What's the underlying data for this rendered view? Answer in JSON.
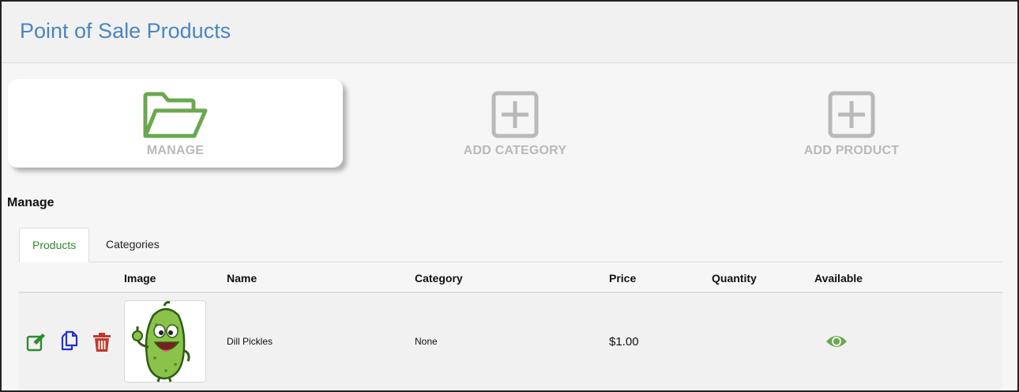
{
  "header": {
    "title": "Point of Sale Products"
  },
  "tiles": {
    "manage": {
      "label": "MANAGE",
      "icon": "folder-open-icon",
      "color": "#6aa84f"
    },
    "add_category": {
      "label": "ADD CATEGORY",
      "icon": "plus-square-icon"
    },
    "add_product": {
      "label": "ADD PRODUCT",
      "icon": "plus-square-icon"
    }
  },
  "section": {
    "title": "Manage"
  },
  "tabs": [
    {
      "label": "Products",
      "active": true
    },
    {
      "label": "Categories",
      "active": false
    }
  ],
  "table": {
    "columns": [
      "Image",
      "Name",
      "Category",
      "Price",
      "Quantity",
      "Available"
    ],
    "rows": [
      {
        "name": "Dill Pickles",
        "category": "None",
        "price": "$1.00",
        "quantity": "",
        "available": true,
        "image": "pickle-mascot-image",
        "actions": [
          "edit-icon",
          "duplicate-icon",
          "trash-icon"
        ]
      }
    ]
  },
  "colors": {
    "title": "#4a86c1",
    "active_tab": "#2f8a2f",
    "edit": "#2e8b2e",
    "duplicate": "#2233cc",
    "delete": "#c0392b",
    "available": "#6aa84f",
    "inactive_tile": "#b9b9b9"
  }
}
